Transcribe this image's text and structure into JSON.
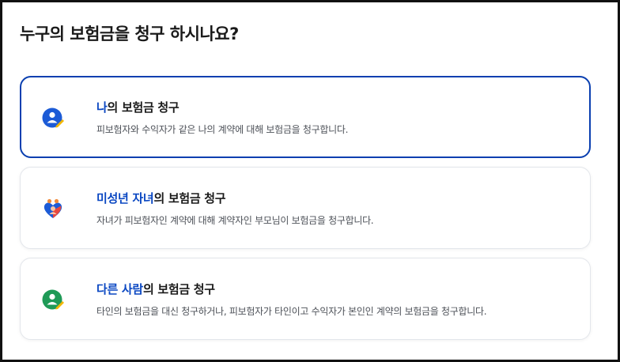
{
  "page": {
    "title": "누구의 보험금을 청구 하시나요?"
  },
  "colors": {
    "accent": "#0a47c2",
    "selected_border": "#0a3fb0",
    "icon_blue": "#1c5bd6",
    "icon_green": "#1f9a57",
    "icon_red": "#e8483f",
    "icon_yellow": "#f2b705"
  },
  "options": [
    {
      "title_highlight": "나",
      "title_rest": "의 보험금 청구",
      "description": "피보험자와 수익자가 같은 나의 계약에 대해 보험금을 청구합니다.",
      "icon": "person-check-icon",
      "selected": true
    },
    {
      "title_highlight": "미성년 자녀",
      "title_rest": "의 보험금 청구",
      "description": "자녀가 피보험자인 계약에 대해 계약자인 부모님이 보험금을 청구합니다.",
      "icon": "family-heart-icon",
      "selected": false
    },
    {
      "title_highlight": "다른 사람",
      "title_rest": "의 보험금 청구",
      "description": "타인의 보험금을 대신 청구하거나, 피보험자가 타인이고 수익자가 본인인 계약의 보험금을 청구합니다.",
      "icon": "person-edit-icon",
      "selected": false
    }
  ]
}
